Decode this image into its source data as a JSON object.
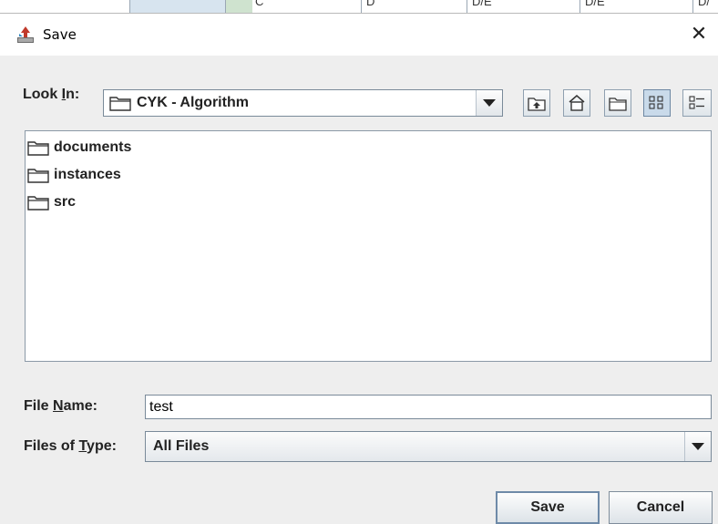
{
  "window": {
    "title": "Save",
    "close_glyph": "✕"
  },
  "look_in": {
    "label": "Look In:",
    "mnemonic": "I",
    "value": "CYK - Algorithm"
  },
  "toolbar": [
    {
      "name": "up-one-level",
      "icon": "up-folder-icon"
    },
    {
      "name": "home",
      "icon": "home-icon"
    },
    {
      "name": "create-new-folder",
      "icon": "new-folder-icon"
    },
    {
      "name": "list-view",
      "icon": "list-view-icon",
      "active": true
    },
    {
      "name": "details-view",
      "icon": "details-view-icon",
      "active": false
    }
  ],
  "files": [
    {
      "name": "documents",
      "icon": "folder-icon"
    },
    {
      "name": "instances",
      "icon": "folder-icon"
    },
    {
      "name": "src",
      "icon": "folder-icon"
    }
  ],
  "file_name": {
    "label": "File Name:",
    "mnemonic": "N",
    "value": "test"
  },
  "file_type": {
    "label": "Files of Type:",
    "mnemonic": "T",
    "value": "All Files"
  },
  "buttons": {
    "save": "Save",
    "cancel": "Cancel"
  },
  "background_strip": {
    "cells": [
      "C",
      "D",
      "D/E",
      "D/E",
      "D/"
    ]
  },
  "colors": {
    "dialog_bg": "#eeeeee",
    "accent_border": "#6e8aa8",
    "toggle_active": "#c9daea"
  }
}
